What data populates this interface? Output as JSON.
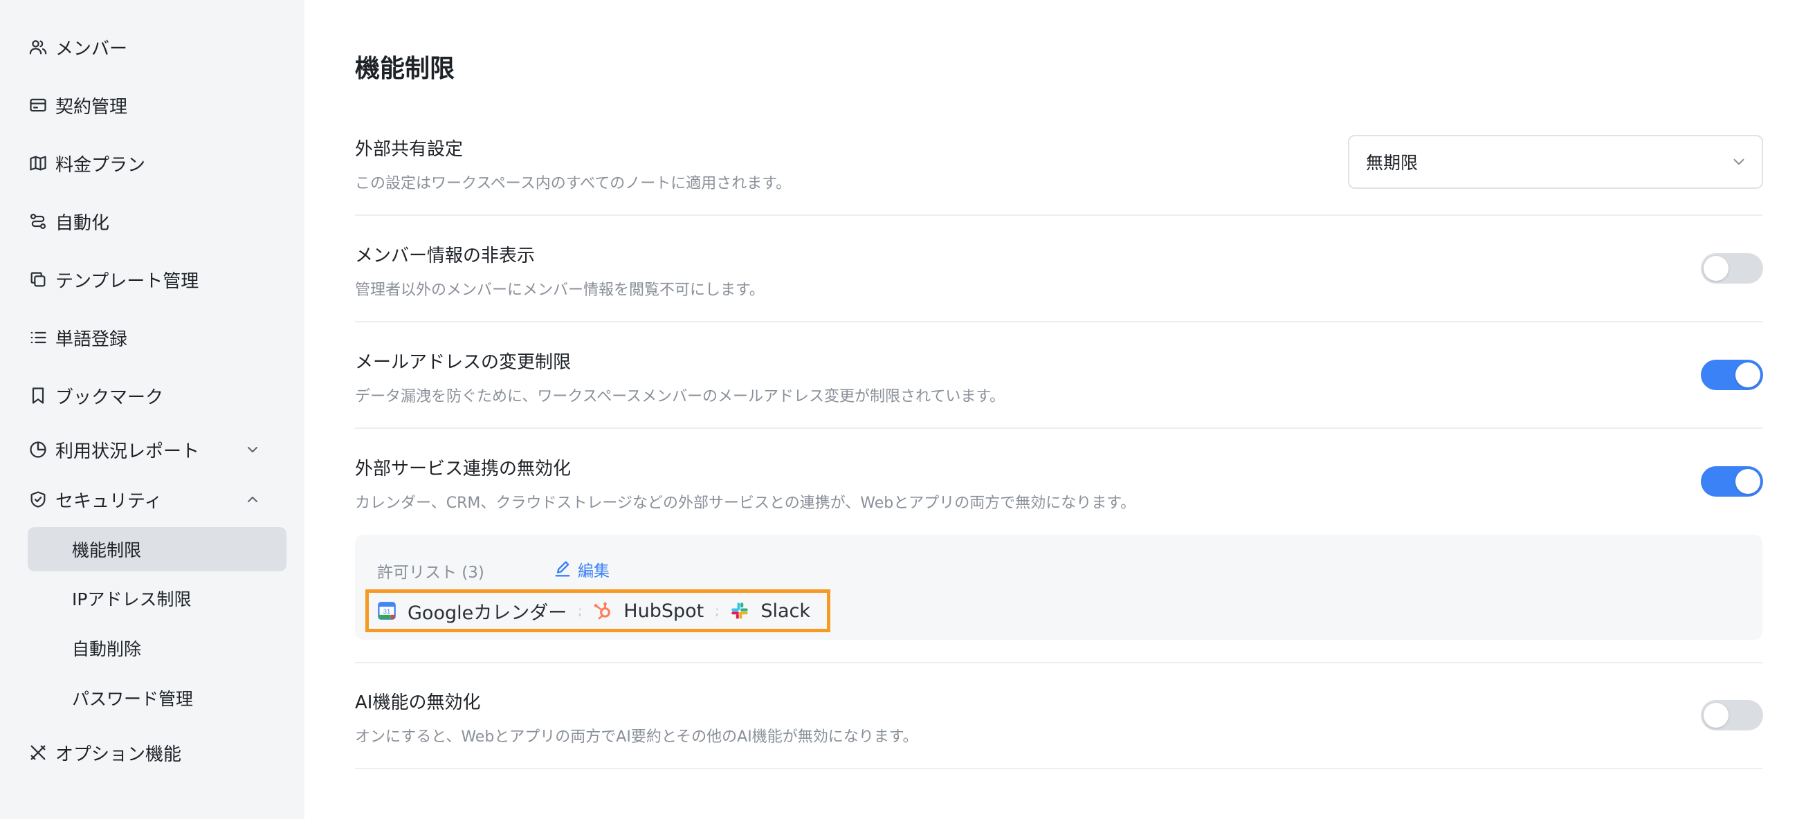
{
  "sidebar": {
    "items": [
      {
        "label": "メンバー",
        "icon": "users-icon"
      },
      {
        "label": "契約管理",
        "icon": "credit-card-icon"
      },
      {
        "label": "料金プラン",
        "icon": "map-icon"
      },
      {
        "label": "自動化",
        "icon": "workflow-icon"
      },
      {
        "label": "テンプレート管理",
        "icon": "copy-icon"
      },
      {
        "label": "単語登録",
        "icon": "list-icon"
      },
      {
        "label": "ブックマーク",
        "icon": "bookmark-icon"
      },
      {
        "label": "利用状況レポート",
        "icon": "pie-chart-icon",
        "expanded": false
      },
      {
        "label": "セキュリティ",
        "icon": "shield-check-icon",
        "expanded": true
      }
    ],
    "security_sub": [
      {
        "label": "機能制限",
        "active": true
      },
      {
        "label": "IPアドレス制限",
        "active": false
      },
      {
        "label": "自動削除",
        "active": false
      },
      {
        "label": "パスワード管理",
        "active": false
      }
    ],
    "options": {
      "label": "オプション機能",
      "icon": "tools-icon"
    }
  },
  "main": {
    "title": "機能制限",
    "external_share": {
      "title": "外部共有設定",
      "desc": "この設定はワークスペース内のすべてのノートに適用されます。",
      "value": "無期限"
    },
    "hide_member": {
      "title": "メンバー情報の非表示",
      "desc": "管理者以外のメンバーにメンバー情報を閲覧不可にします。",
      "enabled": false
    },
    "email_change": {
      "title": "メールアドレスの変更制限",
      "desc": "データ漏洩を防ぐために、ワークスペースメンバーのメールアドレス変更が制限されています。",
      "enabled": true
    },
    "external_service": {
      "title": "外部サービス連携の無効化",
      "desc": "カレンダー、CRM、クラウドストレージなどの外部サービスとの連携が、Webとアプリの両方で無効になります。",
      "enabled": true,
      "allowlist_label": "許可リスト (3)",
      "edit_label": "編集",
      "apps": [
        "Googleカレンダー",
        "HubSpot",
        "Slack"
      ],
      "separator": ";",
      "highlight_color": "#f59a23"
    },
    "ai_disable": {
      "title": "AI機能の無効化",
      "desc": "オンにすると、Webとアプリの両方でAI要約とその他のAI機能が無効になります。",
      "enabled": false
    }
  },
  "colors": {
    "accent": "#3b82f6",
    "sidebar_bg": "#f4f5f7",
    "toggle_off": "#dadde2"
  }
}
